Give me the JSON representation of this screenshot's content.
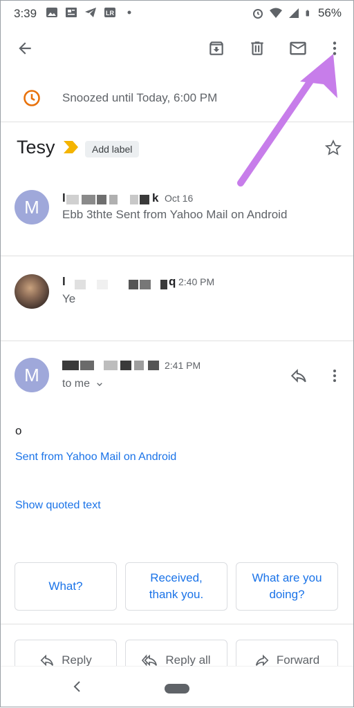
{
  "status_bar": {
    "time": "3:39",
    "battery": "56%"
  },
  "toolbar": {
    "back": "back-icon",
    "archive": "archive-icon",
    "delete": "delete-icon",
    "mark_unread": "mail-icon",
    "more": "more-vert-icon"
  },
  "snooze": {
    "text": "Snoozed until Today, 6:00 PM"
  },
  "subject": {
    "title": "Tesy",
    "label_button": "Add label"
  },
  "messages": [
    {
      "avatar_letter": "M",
      "sender_visible_prefix": "l",
      "sender_visible_suffix": "k",
      "time": "Oct 16",
      "snippet": "Ebb 3thte Sent from Yahoo Mail on Android"
    },
    {
      "sender_visible_prefix": "l",
      "sender_visible_suffix": "q",
      "time": "2:40 PM",
      "snippet": "Ye"
    },
    {
      "avatar_letter": "M",
      "time": "2:41 PM",
      "to": "to me",
      "body": "o",
      "signature_link": "Sent from Yahoo Mail on Android",
      "quoted_link": "Show quoted text"
    }
  ],
  "smart_replies": [
    "What?",
    "Received, thank you.",
    "What are you doing?"
  ],
  "actions": {
    "reply": "Reply",
    "reply_all": "Reply all",
    "forward": "Forward"
  },
  "colors": {
    "accent_blue": "#1a73e8",
    "snooze_orange": "#e8710a",
    "avatar_purple": "#9fa8da",
    "annotation_arrow": "#c77dea"
  }
}
